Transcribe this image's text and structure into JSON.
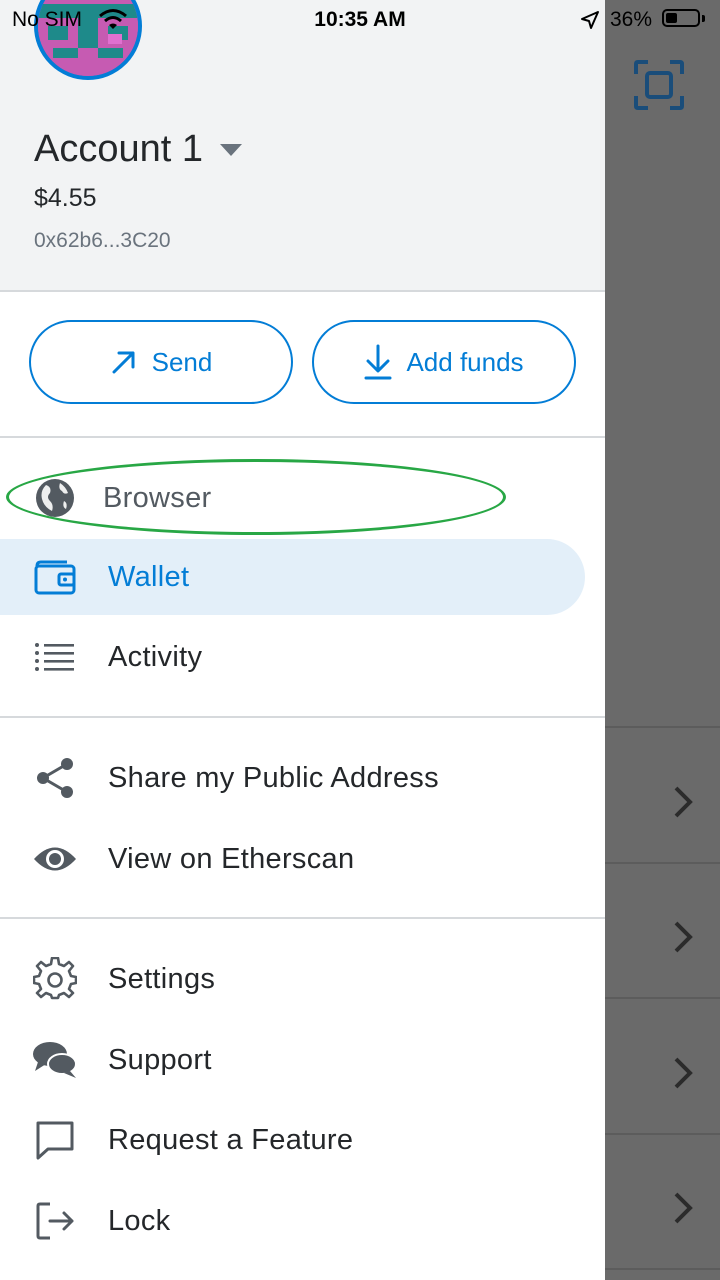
{
  "status_bar": {
    "carrier": "No SIM",
    "time": "10:35 AM",
    "battery": "36%",
    "battery_level": 0.36
  },
  "account": {
    "name": "Account 1",
    "balance": "$4.55",
    "address": "0x62b6...3C20"
  },
  "actions": {
    "send_label": "Send",
    "add_funds_label": "Add funds"
  },
  "menu": {
    "browser": "Browser",
    "wallet": "Wallet",
    "activity": "Activity",
    "share": "Share my Public Address",
    "etherscan": "View on Etherscan",
    "settings": "Settings",
    "support": "Support",
    "request": "Request a Feature",
    "lock": "Lock"
  },
  "colors": {
    "accent": "#037dd6",
    "selected_bg": "#e3eff9",
    "highlight": "#28a745"
  },
  "icons": [
    "wifi-icon",
    "location-arrow-icon",
    "battery-icon",
    "scan-icon",
    "arrow-up-right-icon",
    "download-icon",
    "globe-icon",
    "wallet-icon",
    "list-icon",
    "share-icon",
    "eye-icon",
    "gear-icon",
    "chat-bubbles-icon",
    "message-square-icon",
    "logout-icon",
    "chevron-right-icon"
  ]
}
